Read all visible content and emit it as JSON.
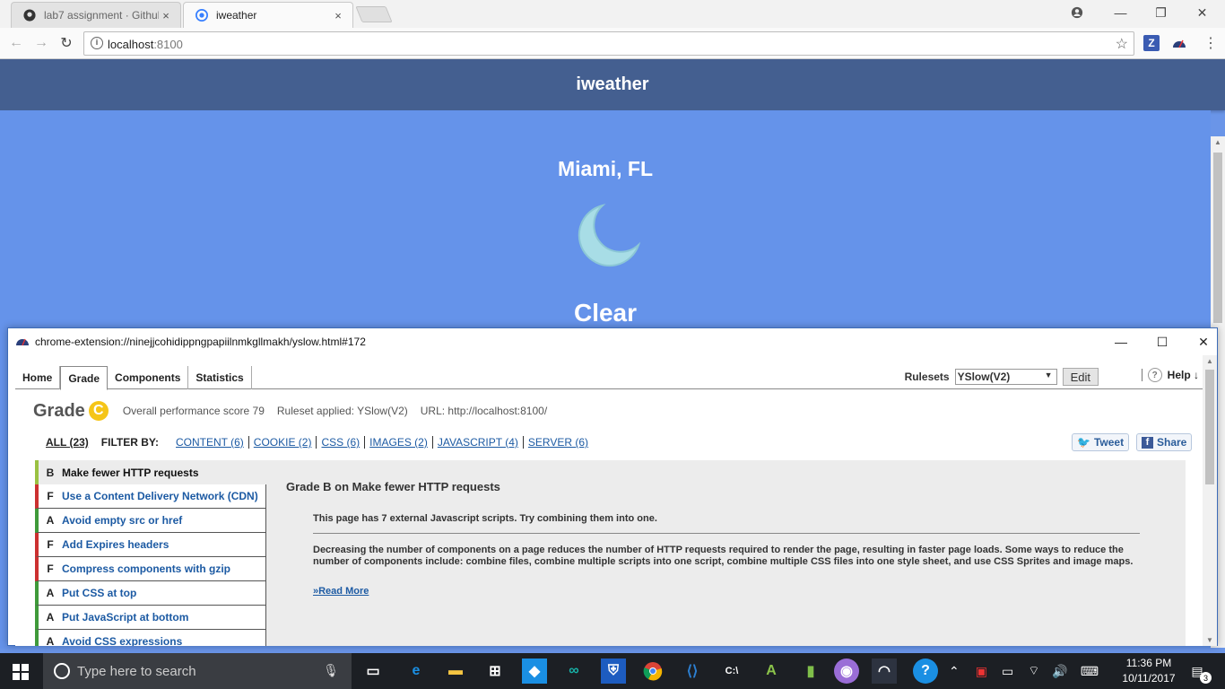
{
  "browser": {
    "tabs": [
      {
        "title": "lab7 assignment · Githuk",
        "close": "×"
      },
      {
        "title": "iweather",
        "close": "×"
      }
    ],
    "window_controls": {
      "minimize": "—",
      "maximize": "❐",
      "close": "✕"
    },
    "address": {
      "host": "localhost",
      "port": ":8100"
    },
    "extensions": [
      {
        "icon": "zotero-icon",
        "letter": "Z",
        "color": "#3a5bb2"
      },
      {
        "icon": "yslow-icon",
        "letter": "",
        "color": "#2a3f7a"
      }
    ]
  },
  "app": {
    "header_title": "iweather",
    "city": "Miami, FL",
    "weather_icon": "moon-icon",
    "condition": "Clear"
  },
  "yslow": {
    "window_url": "chrome-extension://ninejjcohidippngpapiilnmkgllmakh/yslow.html#172",
    "tabs": [
      "Home",
      "Grade",
      "Components",
      "Statistics"
    ],
    "active_tab": "Grade",
    "rulesets_label": "Rulesets",
    "ruleset_selected": "YSlow(V2)",
    "edit_label": "Edit",
    "help_label": "Help ↓",
    "grade_label": "Grade",
    "grade_letter": "C",
    "overall_score_text": "Overall performance score 79",
    "ruleset_applied_text": "Ruleset applied: YSlow(V2)",
    "url_text": "URL: http://localhost:8100/",
    "filter_all": "ALL (23)",
    "filter_by": "FILTER BY:",
    "filters": [
      "CONTENT (6)",
      "COOKIE (2)",
      "CSS (6)",
      "IMAGES (2)",
      "JAVASCRIPT (4)",
      "SERVER (6)"
    ],
    "tweet_label": "Tweet",
    "share_label": "Share",
    "rules": [
      {
        "grade": "B",
        "name": "Make fewer HTTP requests"
      },
      {
        "grade": "F",
        "name": "Use a Content Delivery Network (CDN)"
      },
      {
        "grade": "A",
        "name": "Avoid empty src or href"
      },
      {
        "grade": "F",
        "name": "Add Expires headers"
      },
      {
        "grade": "F",
        "name": "Compress components with gzip"
      },
      {
        "grade": "A",
        "name": "Put CSS at top"
      },
      {
        "grade": "A",
        "name": "Put JavaScript at bottom"
      },
      {
        "grade": "A",
        "name": "Avoid CSS expressions"
      }
    ],
    "detail": {
      "heading": "Grade B on Make fewer HTTP requests",
      "message": "This page has 7 external Javascript scripts. Try combining them into one.",
      "description": "Decreasing the number of components on a page reduces the number of HTTP requests required to render the page, resulting in faster page loads. Some ways to reduce the number of components include: combine files, combine multiple scripts into one script, combine multiple CSS files into one style sheet, and use CSS Sprites and image maps.",
      "read_more": "»Read More"
    }
  },
  "taskbar": {
    "search_placeholder": "Type here to search",
    "time": "11:36 PM",
    "date": "10/11/2017",
    "notification_count": "3"
  }
}
